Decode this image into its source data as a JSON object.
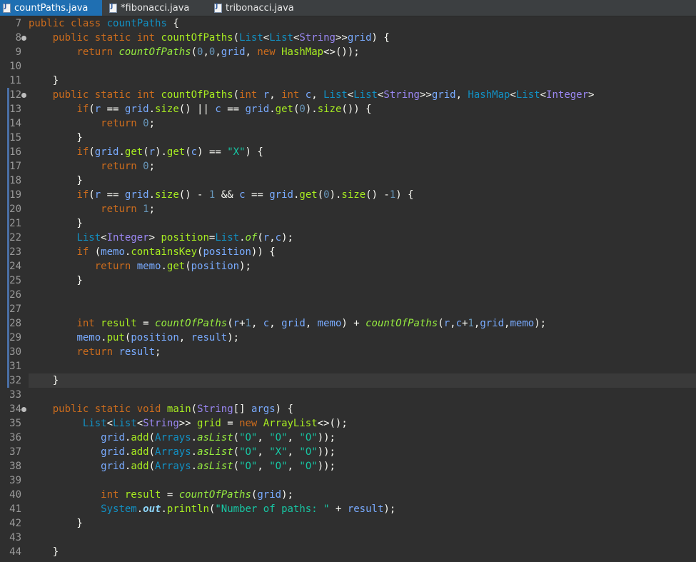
{
  "tabs": [
    {
      "label": "countPaths.java",
      "active": true
    },
    {
      "label": "*fibonacci.java",
      "active": false
    },
    {
      "label": "tribonacci.java",
      "active": false
    }
  ],
  "editor": {
    "first_line_number": 7,
    "current_line": 32,
    "fold_markers": [
      8,
      12,
      34
    ],
    "lines": [
      [
        [
          "kw",
          "public "
        ],
        [
          "kw",
          "class "
        ],
        [
          "cls",
          "countPaths"
        ],
        [
          "plain",
          " {"
        ]
      ],
      [
        [
          "plain",
          "    "
        ],
        [
          "kw",
          "public "
        ],
        [
          "kw",
          "static "
        ],
        [
          "kw",
          "int "
        ],
        [
          "mth",
          "countOfPaths"
        ],
        [
          "plain",
          "("
        ],
        [
          "cls",
          "List"
        ],
        [
          "plain",
          "<"
        ],
        [
          "cls",
          "List"
        ],
        [
          "plain",
          "<"
        ],
        [
          "typ",
          "String"
        ],
        [
          "plain",
          ">>"
        ],
        [
          "var",
          "grid"
        ],
        [
          "plain",
          ") {"
        ]
      ],
      [
        [
          "plain",
          "        "
        ],
        [
          "kw",
          "return "
        ],
        [
          "smth",
          "countOfPaths"
        ],
        [
          "plain",
          "("
        ],
        [
          "num",
          "0"
        ],
        [
          "plain",
          ","
        ],
        [
          "num",
          "0"
        ],
        [
          "plain",
          ","
        ],
        [
          "var",
          "grid"
        ],
        [
          "plain",
          ", "
        ],
        [
          "kw",
          "new "
        ],
        [
          "mth",
          "HashMap"
        ],
        [
          "plain",
          "<>());"
        ]
      ],
      [],
      [
        [
          "plain",
          "    }"
        ]
      ],
      [
        [
          "plain",
          "    "
        ],
        [
          "kw",
          "public "
        ],
        [
          "kw",
          "static "
        ],
        [
          "kw",
          "int "
        ],
        [
          "mth",
          "countOfPaths"
        ],
        [
          "plain",
          "("
        ],
        [
          "kw",
          "int "
        ],
        [
          "var",
          "r"
        ],
        [
          "plain",
          ", "
        ],
        [
          "kw",
          "int "
        ],
        [
          "var",
          "c"
        ],
        [
          "plain",
          ", "
        ],
        [
          "cls",
          "List"
        ],
        [
          "plain",
          "<"
        ],
        [
          "cls",
          "List"
        ],
        [
          "plain",
          "<"
        ],
        [
          "typ",
          "String"
        ],
        [
          "plain",
          ">>"
        ],
        [
          "var",
          "grid"
        ],
        [
          "plain",
          ", "
        ],
        [
          "cls",
          "HashMap"
        ],
        [
          "plain",
          "<"
        ],
        [
          "cls",
          "List"
        ],
        [
          "plain",
          "<"
        ],
        [
          "typ",
          "Integer"
        ],
        [
          "plain",
          ">"
        ]
      ],
      [
        [
          "plain",
          "        "
        ],
        [
          "kw",
          "if"
        ],
        [
          "plain",
          "("
        ],
        [
          "var",
          "r"
        ],
        [
          "plain",
          " == "
        ],
        [
          "var",
          "grid"
        ],
        [
          "plain",
          "."
        ],
        [
          "mth",
          "size"
        ],
        [
          "plain",
          "() || "
        ],
        [
          "var",
          "c"
        ],
        [
          "plain",
          " == "
        ],
        [
          "var",
          "grid"
        ],
        [
          "plain",
          "."
        ],
        [
          "mth",
          "get"
        ],
        [
          "plain",
          "("
        ],
        [
          "num",
          "0"
        ],
        [
          "plain",
          ")."
        ],
        [
          "mth",
          "size"
        ],
        [
          "plain",
          "()) {"
        ]
      ],
      [
        [
          "plain",
          "            "
        ],
        [
          "kw",
          "return "
        ],
        [
          "num",
          "0"
        ],
        [
          "plain",
          ";"
        ]
      ],
      [
        [
          "plain",
          "        }"
        ]
      ],
      [
        [
          "plain",
          "        "
        ],
        [
          "kw",
          "if"
        ],
        [
          "plain",
          "("
        ],
        [
          "var",
          "grid"
        ],
        [
          "plain",
          "."
        ],
        [
          "mth",
          "get"
        ],
        [
          "plain",
          "("
        ],
        [
          "var",
          "r"
        ],
        [
          "plain",
          ")."
        ],
        [
          "mth",
          "get"
        ],
        [
          "plain",
          "("
        ],
        [
          "var",
          "c"
        ],
        [
          "plain",
          ") == "
        ],
        [
          "str",
          "\"X\""
        ],
        [
          "plain",
          ") {"
        ]
      ],
      [
        [
          "plain",
          "            "
        ],
        [
          "kw",
          "return "
        ],
        [
          "num",
          "0"
        ],
        [
          "plain",
          ";"
        ]
      ],
      [
        [
          "plain",
          "        }"
        ]
      ],
      [
        [
          "plain",
          "        "
        ],
        [
          "kw",
          "if"
        ],
        [
          "plain",
          "("
        ],
        [
          "var",
          "r"
        ],
        [
          "plain",
          " == "
        ],
        [
          "var",
          "grid"
        ],
        [
          "plain",
          "."
        ],
        [
          "mth",
          "size"
        ],
        [
          "plain",
          "() - "
        ],
        [
          "num",
          "1"
        ],
        [
          "plain",
          " && "
        ],
        [
          "var",
          "c"
        ],
        [
          "plain",
          " == "
        ],
        [
          "var",
          "grid"
        ],
        [
          "plain",
          "."
        ],
        [
          "mth",
          "get"
        ],
        [
          "plain",
          "("
        ],
        [
          "num",
          "0"
        ],
        [
          "plain",
          ")."
        ],
        [
          "mth",
          "size"
        ],
        [
          "plain",
          "() -"
        ],
        [
          "num",
          "1"
        ],
        [
          "plain",
          ") {"
        ]
      ],
      [
        [
          "plain",
          "            "
        ],
        [
          "kw",
          "return "
        ],
        [
          "num",
          "1"
        ],
        [
          "plain",
          ";"
        ]
      ],
      [
        [
          "plain",
          "        }"
        ]
      ],
      [
        [
          "plain",
          "        "
        ],
        [
          "cls",
          "List"
        ],
        [
          "plain",
          "<"
        ],
        [
          "typ",
          "Integer"
        ],
        [
          "plain",
          "> "
        ],
        [
          "mth",
          "position"
        ],
        [
          "plain",
          "="
        ],
        [
          "cls",
          "List"
        ],
        [
          "plain",
          "."
        ],
        [
          "smth",
          "of"
        ],
        [
          "plain",
          "("
        ],
        [
          "var",
          "r"
        ],
        [
          "plain",
          ","
        ],
        [
          "var",
          "c"
        ],
        [
          "plain",
          ");"
        ]
      ],
      [
        [
          "plain",
          "        "
        ],
        [
          "kw",
          "if "
        ],
        [
          "plain",
          "("
        ],
        [
          "var",
          "memo"
        ],
        [
          "plain",
          "."
        ],
        [
          "mth",
          "containsKey"
        ],
        [
          "plain",
          "("
        ],
        [
          "var",
          "position"
        ],
        [
          "plain",
          ")) {"
        ]
      ],
      [
        [
          "plain",
          "           "
        ],
        [
          "kw",
          "return "
        ],
        [
          "var",
          "memo"
        ],
        [
          "plain",
          "."
        ],
        [
          "mth",
          "get"
        ],
        [
          "plain",
          "("
        ],
        [
          "var",
          "position"
        ],
        [
          "plain",
          ");"
        ]
      ],
      [
        [
          "plain",
          "        }"
        ]
      ],
      [],
      [],
      [
        [
          "plain",
          "        "
        ],
        [
          "kw",
          "int "
        ],
        [
          "mth",
          "result"
        ],
        [
          "plain",
          " = "
        ],
        [
          "smth",
          "countOfPaths"
        ],
        [
          "plain",
          "("
        ],
        [
          "var",
          "r"
        ],
        [
          "plain",
          "+"
        ],
        [
          "num",
          "1"
        ],
        [
          "plain",
          ", "
        ],
        [
          "var",
          "c"
        ],
        [
          "plain",
          ", "
        ],
        [
          "var",
          "grid"
        ],
        [
          "plain",
          ", "
        ],
        [
          "var",
          "memo"
        ],
        [
          "plain",
          ") + "
        ],
        [
          "smth",
          "countOfPaths"
        ],
        [
          "plain",
          "("
        ],
        [
          "var",
          "r"
        ],
        [
          "plain",
          ","
        ],
        [
          "var",
          "c"
        ],
        [
          "plain",
          "+"
        ],
        [
          "num",
          "1"
        ],
        [
          "plain",
          ","
        ],
        [
          "var",
          "grid"
        ],
        [
          "plain",
          ","
        ],
        [
          "var",
          "memo"
        ],
        [
          "plain",
          ");"
        ]
      ],
      [
        [
          "plain",
          "        "
        ],
        [
          "var",
          "memo"
        ],
        [
          "plain",
          "."
        ],
        [
          "mth",
          "put"
        ],
        [
          "plain",
          "("
        ],
        [
          "var",
          "position"
        ],
        [
          "plain",
          ", "
        ],
        [
          "var",
          "result"
        ],
        [
          "plain",
          ");"
        ]
      ],
      [
        [
          "plain",
          "        "
        ],
        [
          "kw",
          "return "
        ],
        [
          "var",
          "result"
        ],
        [
          "plain",
          ";"
        ]
      ],
      [],
      [
        [
          "plain",
          "    }"
        ]
      ],
      [],
      [
        [
          "plain",
          "    "
        ],
        [
          "kw",
          "public "
        ],
        [
          "kw",
          "static "
        ],
        [
          "kw",
          "void "
        ],
        [
          "mth",
          "main"
        ],
        [
          "plain",
          "("
        ],
        [
          "typ",
          "String"
        ],
        [
          "plain",
          "[] "
        ],
        [
          "var",
          "args"
        ],
        [
          "plain",
          ") {"
        ]
      ],
      [
        [
          "plain",
          "         "
        ],
        [
          "cls",
          "List"
        ],
        [
          "plain",
          "<"
        ],
        [
          "cls",
          "List"
        ],
        [
          "plain",
          "<"
        ],
        [
          "typ",
          "String"
        ],
        [
          "plain",
          ">> "
        ],
        [
          "mth",
          "grid"
        ],
        [
          "plain",
          " = "
        ],
        [
          "kw",
          "new "
        ],
        [
          "mth",
          "ArrayList"
        ],
        [
          "plain",
          "<>();"
        ]
      ],
      [
        [
          "plain",
          "            "
        ],
        [
          "var",
          "grid"
        ],
        [
          "plain",
          "."
        ],
        [
          "mth",
          "add"
        ],
        [
          "plain",
          "("
        ],
        [
          "cls",
          "Arrays"
        ],
        [
          "plain",
          "."
        ],
        [
          "smth",
          "asList"
        ],
        [
          "plain",
          "("
        ],
        [
          "str",
          "\"O\""
        ],
        [
          "plain",
          ", "
        ],
        [
          "str",
          "\"O\""
        ],
        [
          "plain",
          ", "
        ],
        [
          "str",
          "\"O\""
        ],
        [
          "plain",
          "));"
        ]
      ],
      [
        [
          "plain",
          "            "
        ],
        [
          "var",
          "grid"
        ],
        [
          "plain",
          "."
        ],
        [
          "mth",
          "add"
        ],
        [
          "plain",
          "("
        ],
        [
          "cls",
          "Arrays"
        ],
        [
          "plain",
          "."
        ],
        [
          "smth",
          "asList"
        ],
        [
          "plain",
          "("
        ],
        [
          "str",
          "\"O\""
        ],
        [
          "plain",
          ", "
        ],
        [
          "str",
          "\"X\""
        ],
        [
          "plain",
          ", "
        ],
        [
          "str",
          "\"O\""
        ],
        [
          "plain",
          "));"
        ]
      ],
      [
        [
          "plain",
          "            "
        ],
        [
          "var",
          "grid"
        ],
        [
          "plain",
          "."
        ],
        [
          "mth",
          "add"
        ],
        [
          "plain",
          "("
        ],
        [
          "cls",
          "Arrays"
        ],
        [
          "plain",
          "."
        ],
        [
          "smth",
          "asList"
        ],
        [
          "plain",
          "("
        ],
        [
          "str",
          "\"O\""
        ],
        [
          "plain",
          ", "
        ],
        [
          "str",
          "\"O\""
        ],
        [
          "plain",
          ", "
        ],
        [
          "str",
          "\"O\""
        ],
        [
          "plain",
          "));"
        ]
      ],
      [],
      [
        [
          "plain",
          "            "
        ],
        [
          "kw",
          "int "
        ],
        [
          "mth",
          "result"
        ],
        [
          "plain",
          " = "
        ],
        [
          "smth",
          "countOfPaths"
        ],
        [
          "plain",
          "("
        ],
        [
          "var",
          "grid"
        ],
        [
          "plain",
          ");"
        ]
      ],
      [
        [
          "plain",
          "            "
        ],
        [
          "cls",
          "System"
        ],
        [
          "plain",
          "."
        ],
        [
          "fld",
          "out"
        ],
        [
          "plain",
          "."
        ],
        [
          "mth",
          "println"
        ],
        [
          "plain",
          "("
        ],
        [
          "str",
          "\"Number of paths: \""
        ],
        [
          "plain",
          " + "
        ],
        [
          "var",
          "result"
        ],
        [
          "plain",
          ");"
        ]
      ],
      [
        [
          "plain",
          "        }"
        ]
      ],
      [],
      [
        [
          "plain",
          "    }"
        ]
      ]
    ]
  }
}
